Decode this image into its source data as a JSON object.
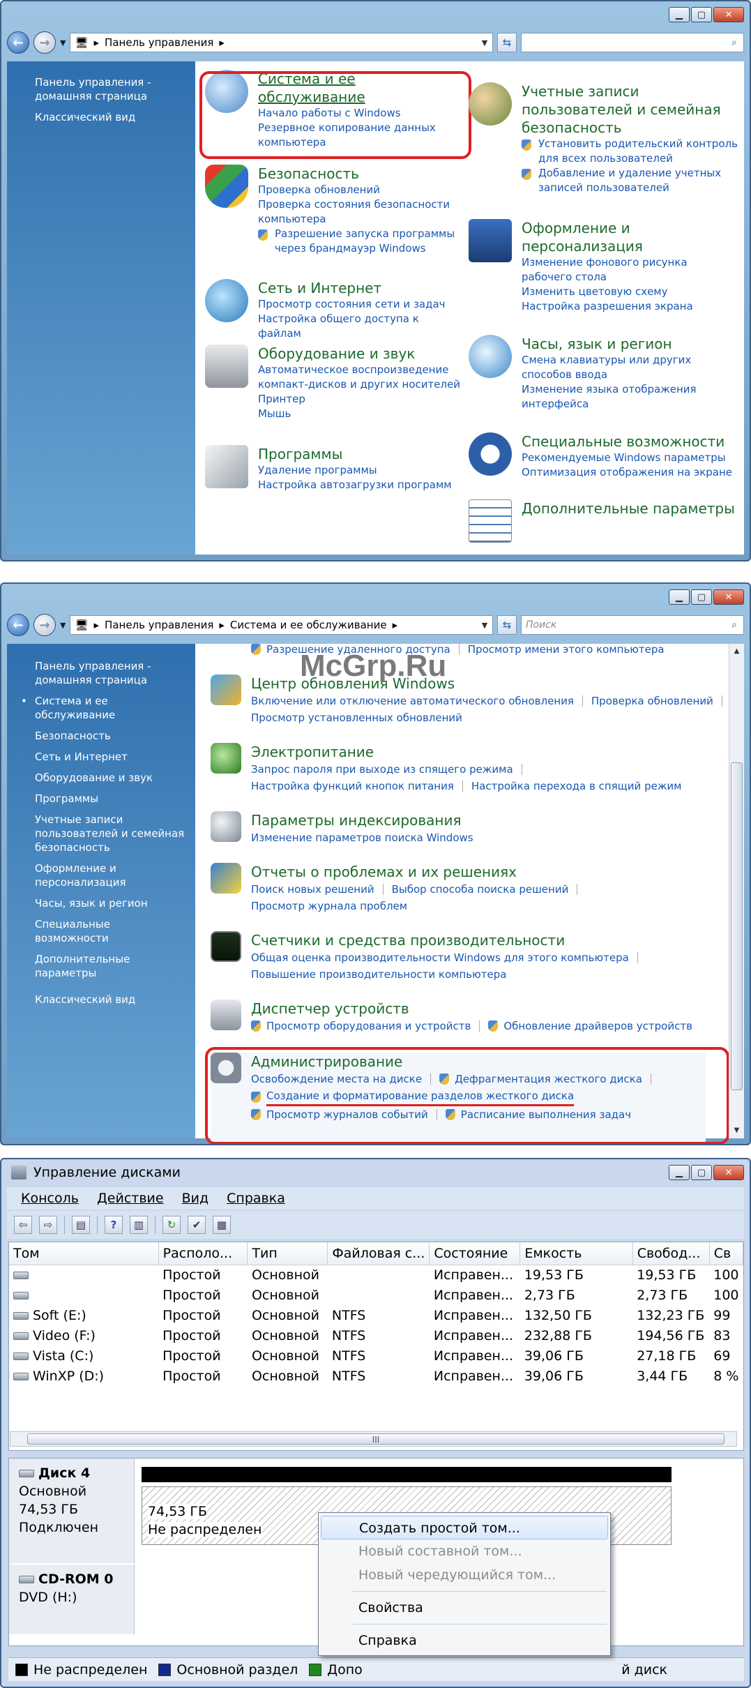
{
  "w1": {
    "address": "Панель управления",
    "search": "",
    "sidebar": [
      "Панель управления - домашняя страница",
      "Классический вид"
    ],
    "categories": {
      "system": {
        "title": "Система и ее обслуживание",
        "links": [
          "Начало работы с Windows",
          "Резервное копирование данных компьютера"
        ]
      },
      "users": {
        "title": "Учетные записи пользователей и семейная безопасность",
        "links": [
          "Установить родительский контроль для всех пользователей",
          "Добавление и удаление учетных записей пользователей"
        ]
      },
      "security": {
        "title": "Безопасность",
        "links": [
          "Проверка обновлений",
          "Проверка состояния безопасности компьютера",
          "Разрешение запуска программы через брандмауэр Windows"
        ]
      },
      "appearance": {
        "title": "Оформление и персонализация",
        "links": [
          "Изменение фонового рисунка рабочего стола",
          "Изменить цветовую схему",
          "Настройка разрешения экрана"
        ]
      },
      "network": {
        "title": "Сеть и Интернет",
        "links": [
          "Просмотр состояния сети и задач",
          "Настройка общего доступа к файлам"
        ]
      },
      "clock": {
        "title": "Часы, язык и регион",
        "links": [
          "Смена клавиатуры или других способов ввода",
          "Изменение языка отображения интерфейса"
        ]
      },
      "hardware": {
        "title": "Оборудование и звук",
        "links": [
          "Автоматическое воспроизведение компакт-дисков и других носителей",
          "Принтер",
          "Мышь"
        ]
      },
      "access": {
        "title": "Специальные возможности",
        "links": [
          "Рекомендуемые Windows параметры",
          "Оптимизация отображения на экране"
        ]
      },
      "programs": {
        "title": "Программы",
        "links": [
          "Удаление программы",
          "Настройка автозагрузки программ"
        ]
      },
      "additional": {
        "title": "Дополнительные параметры"
      }
    }
  },
  "w2": {
    "address1": "Панель управления",
    "address2": "Система и ее обслуживание",
    "search": "Поиск",
    "sidebar": [
      "Панель управления - домашняя страница",
      "Система и ее обслуживание",
      "Безопасность",
      "Сеть и Интернет",
      "Оборудование и звук",
      "Программы",
      "Учетные записи пользователей и семейная безопасность",
      "Оформление и персонализация",
      "Часы, язык и регион",
      "Специальные возможности",
      "Дополнительные параметры",
      "Классический вид"
    ],
    "top_links": [
      "Разрешение удаленного доступа",
      "Просмотр имени этого компьютера"
    ],
    "items": {
      "update": {
        "title": "Центр обновления Windows",
        "links": [
          "Включение или отключение автоматического обновления",
          "Проверка обновлений",
          "Просмотр установленных обновлений"
        ]
      },
      "power": {
        "title": "Электропитание",
        "links": [
          "Запрос пароля при выходе из спящего режима",
          "Настройка функций кнопок питания",
          "Настройка перехода в спящий режим"
        ]
      },
      "index": {
        "title": "Параметры индексирования",
        "links": [
          "Изменение параметров поиска Windows"
        ]
      },
      "problems": {
        "title": "Отчеты о проблемах и их решениях",
        "links": [
          "Поиск новых решений",
          "Выбор способа поиска решений",
          "Просмотр журнала проблем"
        ]
      },
      "perf": {
        "title": "Счетчики и средства производительности",
        "links": [
          "Общая оценка производительности Windows для этого компьютера",
          "Повышение производительности компьютера"
        ]
      },
      "devices": {
        "title": "Диспетчер устройств",
        "links": [
          "Просмотр оборудования и устройств",
          "Обновление драйверов устройств"
        ]
      },
      "admin": {
        "title": "Администрирование",
        "links": [
          "Освобождение места на диске",
          "Дефрагментация жесткого диска",
          "Создание и форматирование разделов жесткого диска",
          "Просмотр журналов событий",
          "Расписание выполнения задач"
        ]
      }
    },
    "watermark": "McGrp.Ru"
  },
  "w3": {
    "title": "Управление дисками",
    "menu": [
      "Консоль",
      "Действие",
      "Вид",
      "Справка"
    ],
    "columns": [
      "Том",
      "Располо...",
      "Тип",
      "Файловая с...",
      "Состояние",
      "Емкость",
      "Свобод...",
      "Св"
    ],
    "rows": [
      [
        "",
        "Простой",
        "Основной",
        "",
        "Исправен...",
        "19,53 ГБ",
        "19,53 ГБ",
        "100"
      ],
      [
        "",
        "Простой",
        "Основной",
        "",
        "Исправен...",
        "2,73 ГБ",
        "2,73 ГБ",
        "100"
      ],
      [
        "Soft (E:)",
        "Простой",
        "Основной",
        "NTFS",
        "Исправен...",
        "132,50 ГБ",
        "132,23 ГБ",
        "99"
      ],
      [
        "Video (F:)",
        "Простой",
        "Основной",
        "NTFS",
        "Исправен...",
        "232,88 ГБ",
        "194,56 ГБ",
        "83"
      ],
      [
        "Vista (C:)",
        "Простой",
        "Основной",
        "NTFS",
        "Исправен...",
        "39,06 ГБ",
        "27,18 ГБ",
        "69"
      ],
      [
        "WinXP (D:)",
        "Простой",
        "Основной",
        "NTFS",
        "Исправен...",
        "39,06 ГБ",
        "3,44 ГБ",
        "8 %"
      ]
    ],
    "hscroll_grip": "III",
    "disk4": {
      "name": "Диск 4",
      "type": "Основной",
      "size": "74,53 ГБ",
      "status": "Подключен",
      "part_size": "74,53 ГБ",
      "part_status": "Не распределен"
    },
    "cdrom": {
      "name": "CD-ROM 0",
      "type": "DVD (H:)"
    },
    "legend": [
      "Не распределен",
      "Основной раздел",
      "Допо",
      "й диск"
    ],
    "context": [
      "Создать простой том...",
      "Новый составной том...",
      "Новый чередующийся том...",
      "Свойства",
      "Справка"
    ]
  }
}
